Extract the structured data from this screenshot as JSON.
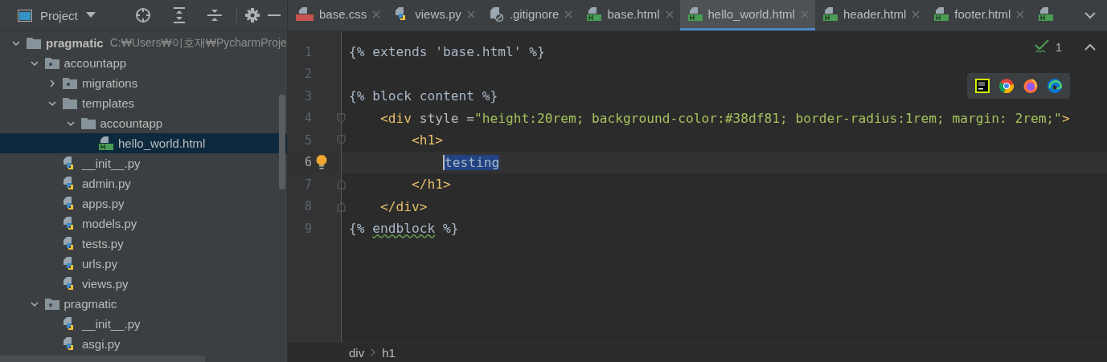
{
  "project_panel": {
    "title": "Project",
    "tree": [
      {
        "label": "pragmatic",
        "kind": "folder",
        "path": "C:₩Users₩이호재₩PycharmProje",
        "expanded": true,
        "selected": false,
        "children": [
          {
            "label": "accountapp",
            "kind": "package",
            "expanded": true,
            "selected": false,
            "children": [
              {
                "label": "migrations",
                "kind": "package",
                "expanded": false,
                "selected": false
              },
              {
                "label": "templates",
                "kind": "folder",
                "expanded": true,
                "selected": false,
                "children": [
                  {
                    "label": "accountapp",
                    "kind": "folder",
                    "expanded": true,
                    "selected": false,
                    "children": [
                      {
                        "label": "hello_world.html",
                        "kind": "html",
                        "selected": true
                      }
                    ]
                  }
                ]
              },
              {
                "label": "__init__.py",
                "kind": "python",
                "selected": false
              },
              {
                "label": "admin.py",
                "kind": "python",
                "selected": false
              },
              {
                "label": "apps.py",
                "kind": "python",
                "selected": false
              },
              {
                "label": "models.py",
                "kind": "python",
                "selected": false
              },
              {
                "label": "tests.py",
                "kind": "python",
                "selected": false
              },
              {
                "label": "urls.py",
                "kind": "python",
                "selected": false
              },
              {
                "label": "views.py",
                "kind": "python",
                "selected": false
              }
            ]
          },
          {
            "label": "pragmatic",
            "kind": "package",
            "expanded": true,
            "selected": false,
            "children": [
              {
                "label": "__init__.py",
                "kind": "python",
                "selected": false
              },
              {
                "label": "asgi.py",
                "kind": "python",
                "selected": false
              }
            ]
          }
        ]
      }
    ]
  },
  "tabs": [
    {
      "label": "base.css",
      "kind": "css",
      "selected": false
    },
    {
      "label": "views.py",
      "kind": "python",
      "selected": false
    },
    {
      "label": ".gitignore",
      "kind": "ignore",
      "selected": false
    },
    {
      "label": "base.html",
      "kind": "html",
      "selected": false
    },
    {
      "label": "hello_world.html",
      "kind": "html",
      "selected": true
    },
    {
      "label": "header.html",
      "kind": "html",
      "selected": false
    },
    {
      "label": "footer.html",
      "kind": "html",
      "selected": false
    },
    {
      "kind": "html",
      "selected": false
    }
  ],
  "inspections": {
    "count": "1"
  },
  "code": [
    {
      "number": "1",
      "current": false,
      "kind": "plain",
      "segments": [
        {
          "kind": "template",
          "text": "{% extends 'base.html' %}"
        }
      ]
    },
    {
      "number": "2",
      "current": false,
      "kind": "plain"
    },
    {
      "number": "3",
      "current": false,
      "kind": "plain",
      "segments": [
        {
          "kind": "template",
          "text": "{% block content %}"
        }
      ]
    },
    {
      "number": "4",
      "current": false,
      "kind": "fold_open",
      "segments": [
        {
          "kind": "tag",
          "text": "    <div"
        },
        {
          "kind": "attr",
          "text": " style ="
        },
        {
          "kind": "string",
          "text": "\"height:20rem; background-color:#38df81; border-radius:1rem; margin: 2rem;\""
        },
        {
          "kind": "tag",
          "text": ">"
        }
      ]
    },
    {
      "number": "5",
      "current": false,
      "kind": "fold_open",
      "segments": [
        {
          "kind": "tag",
          "text": "        <h1>"
        }
      ]
    },
    {
      "number": "6",
      "current": true,
      "kind": "bulb",
      "segments": [
        {
          "kind": "selected",
          "text": "testing"
        }
      ]
    },
    {
      "number": "7",
      "current": false,
      "kind": "fold_close",
      "segments": [
        {
          "kind": "tag",
          "text": "        </h1>"
        }
      ]
    },
    {
      "number": "8",
      "current": false,
      "kind": "fold_close",
      "segments": [
        {
          "kind": "tag",
          "text": "    </div>"
        }
      ]
    },
    {
      "number": "9",
      "current": false,
      "kind": "plain",
      "segments": [
        {
          "kind": "template",
          "text": "{% "
        },
        {
          "kind": "typo",
          "text": "endblock"
        },
        {
          "kind": "template",
          "text": " %}"
        }
      ]
    }
  ],
  "breadcrumbs": [
    "div",
    "h1"
  ]
}
